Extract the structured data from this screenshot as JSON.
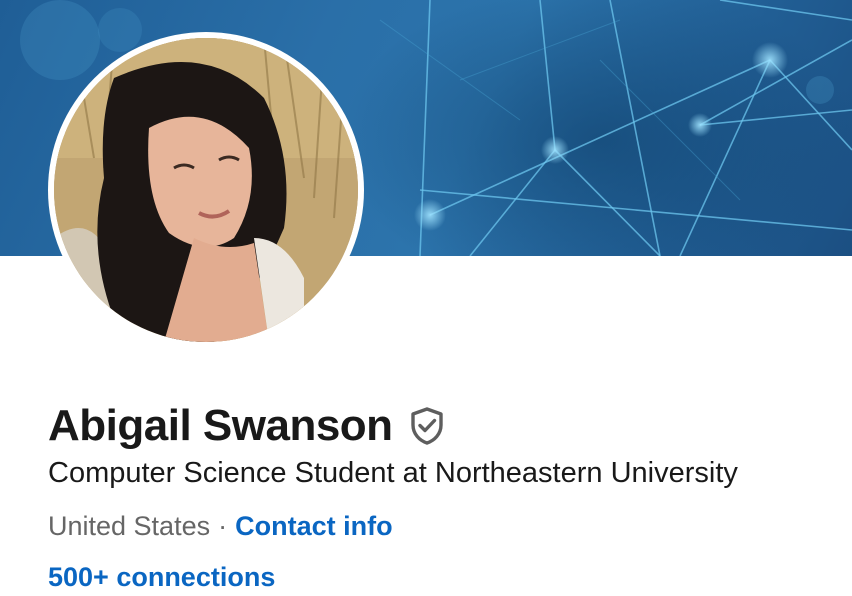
{
  "profile": {
    "name": "Abigail Swanson",
    "headline": "Computer Science Student at Northeastern University",
    "location": "United States",
    "separator": "·",
    "contact_label": "Contact info",
    "connections_label": "500+ connections",
    "verified_icon": "shield-check-icon"
  },
  "colors": {
    "link": "#0a66c2",
    "banner": "#2a6fa8",
    "text": "#191919",
    "muted": "#666666"
  }
}
